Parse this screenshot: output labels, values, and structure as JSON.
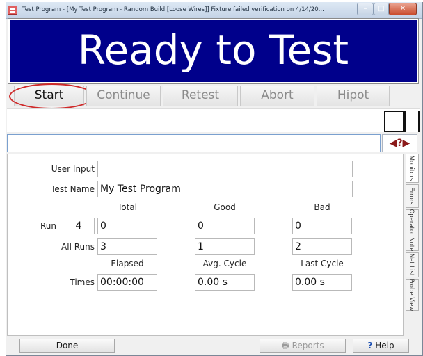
{
  "window": {
    "title": "Test Program - [My Test Program - Random Build [Loose Wires]]  Fixture failed verification on 4/14/20..."
  },
  "banner": {
    "status": "Ready to Test"
  },
  "toolbar": {
    "start": "Start",
    "continue": "Continue",
    "retest": "Retest",
    "abort": "Abort",
    "hipot": "Hipot"
  },
  "message": {
    "value": "",
    "nav_symbol": "◀?▶"
  },
  "form": {
    "user_input_label": "User Input",
    "user_input_value": "",
    "test_name_label": "Test Name",
    "test_name_value": "My Test Program",
    "headers": {
      "total": "Total",
      "good": "Good",
      "bad": "Bad"
    },
    "run": {
      "label": "Run",
      "number": "4",
      "total": "0",
      "good": "0",
      "bad": "0"
    },
    "all_runs": {
      "label": "All Runs",
      "total": "3",
      "good": "1",
      "bad": "2"
    },
    "time_headers": {
      "elapsed": "Elapsed",
      "avg_cycle": "Avg. Cycle",
      "last_cycle": "Last Cycle"
    },
    "times": {
      "label": "Times",
      "elapsed": "00:00:00",
      "avg_cycle": "0.00 s",
      "last_cycle": "0.00 s"
    }
  },
  "side_tabs": [
    "Monitors",
    "Errors",
    "Operator Note",
    "Net List",
    "Probe View"
  ],
  "footer": {
    "done": "Done",
    "reports": "Reports",
    "help": "Help",
    "help_icon": "?"
  },
  "colors": {
    "banner_bg": "#00008b",
    "highlight_ring": "#cf2a2a"
  }
}
